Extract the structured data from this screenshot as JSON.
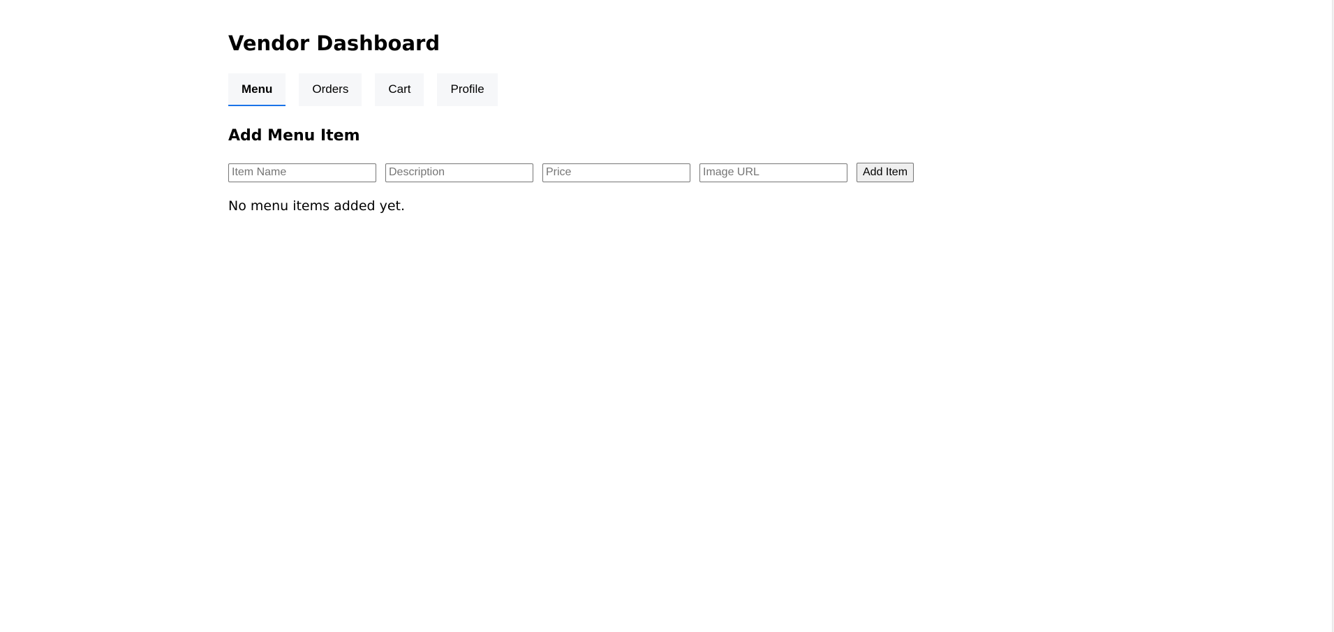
{
  "page": {
    "title": "Vendor Dashboard"
  },
  "tabs": [
    {
      "label": "Menu",
      "active": true
    },
    {
      "label": "Orders",
      "active": false
    },
    {
      "label": "Cart",
      "active": false
    },
    {
      "label": "Profile",
      "active": false
    }
  ],
  "add_menu_item": {
    "heading": "Add Menu Item",
    "fields": {
      "item_name": {
        "placeholder": "Item Name",
        "value": ""
      },
      "description": {
        "placeholder": "Description",
        "value": ""
      },
      "price": {
        "placeholder": "Price",
        "value": ""
      },
      "image_url": {
        "placeholder": "Image URL",
        "value": ""
      }
    },
    "submit_label": "Add Item"
  },
  "menu_list": {
    "empty_message": "No menu items added yet."
  },
  "colors": {
    "accent": "#1a73e8",
    "tab_background": "#f6f7f9",
    "button_background": "#efefef"
  }
}
